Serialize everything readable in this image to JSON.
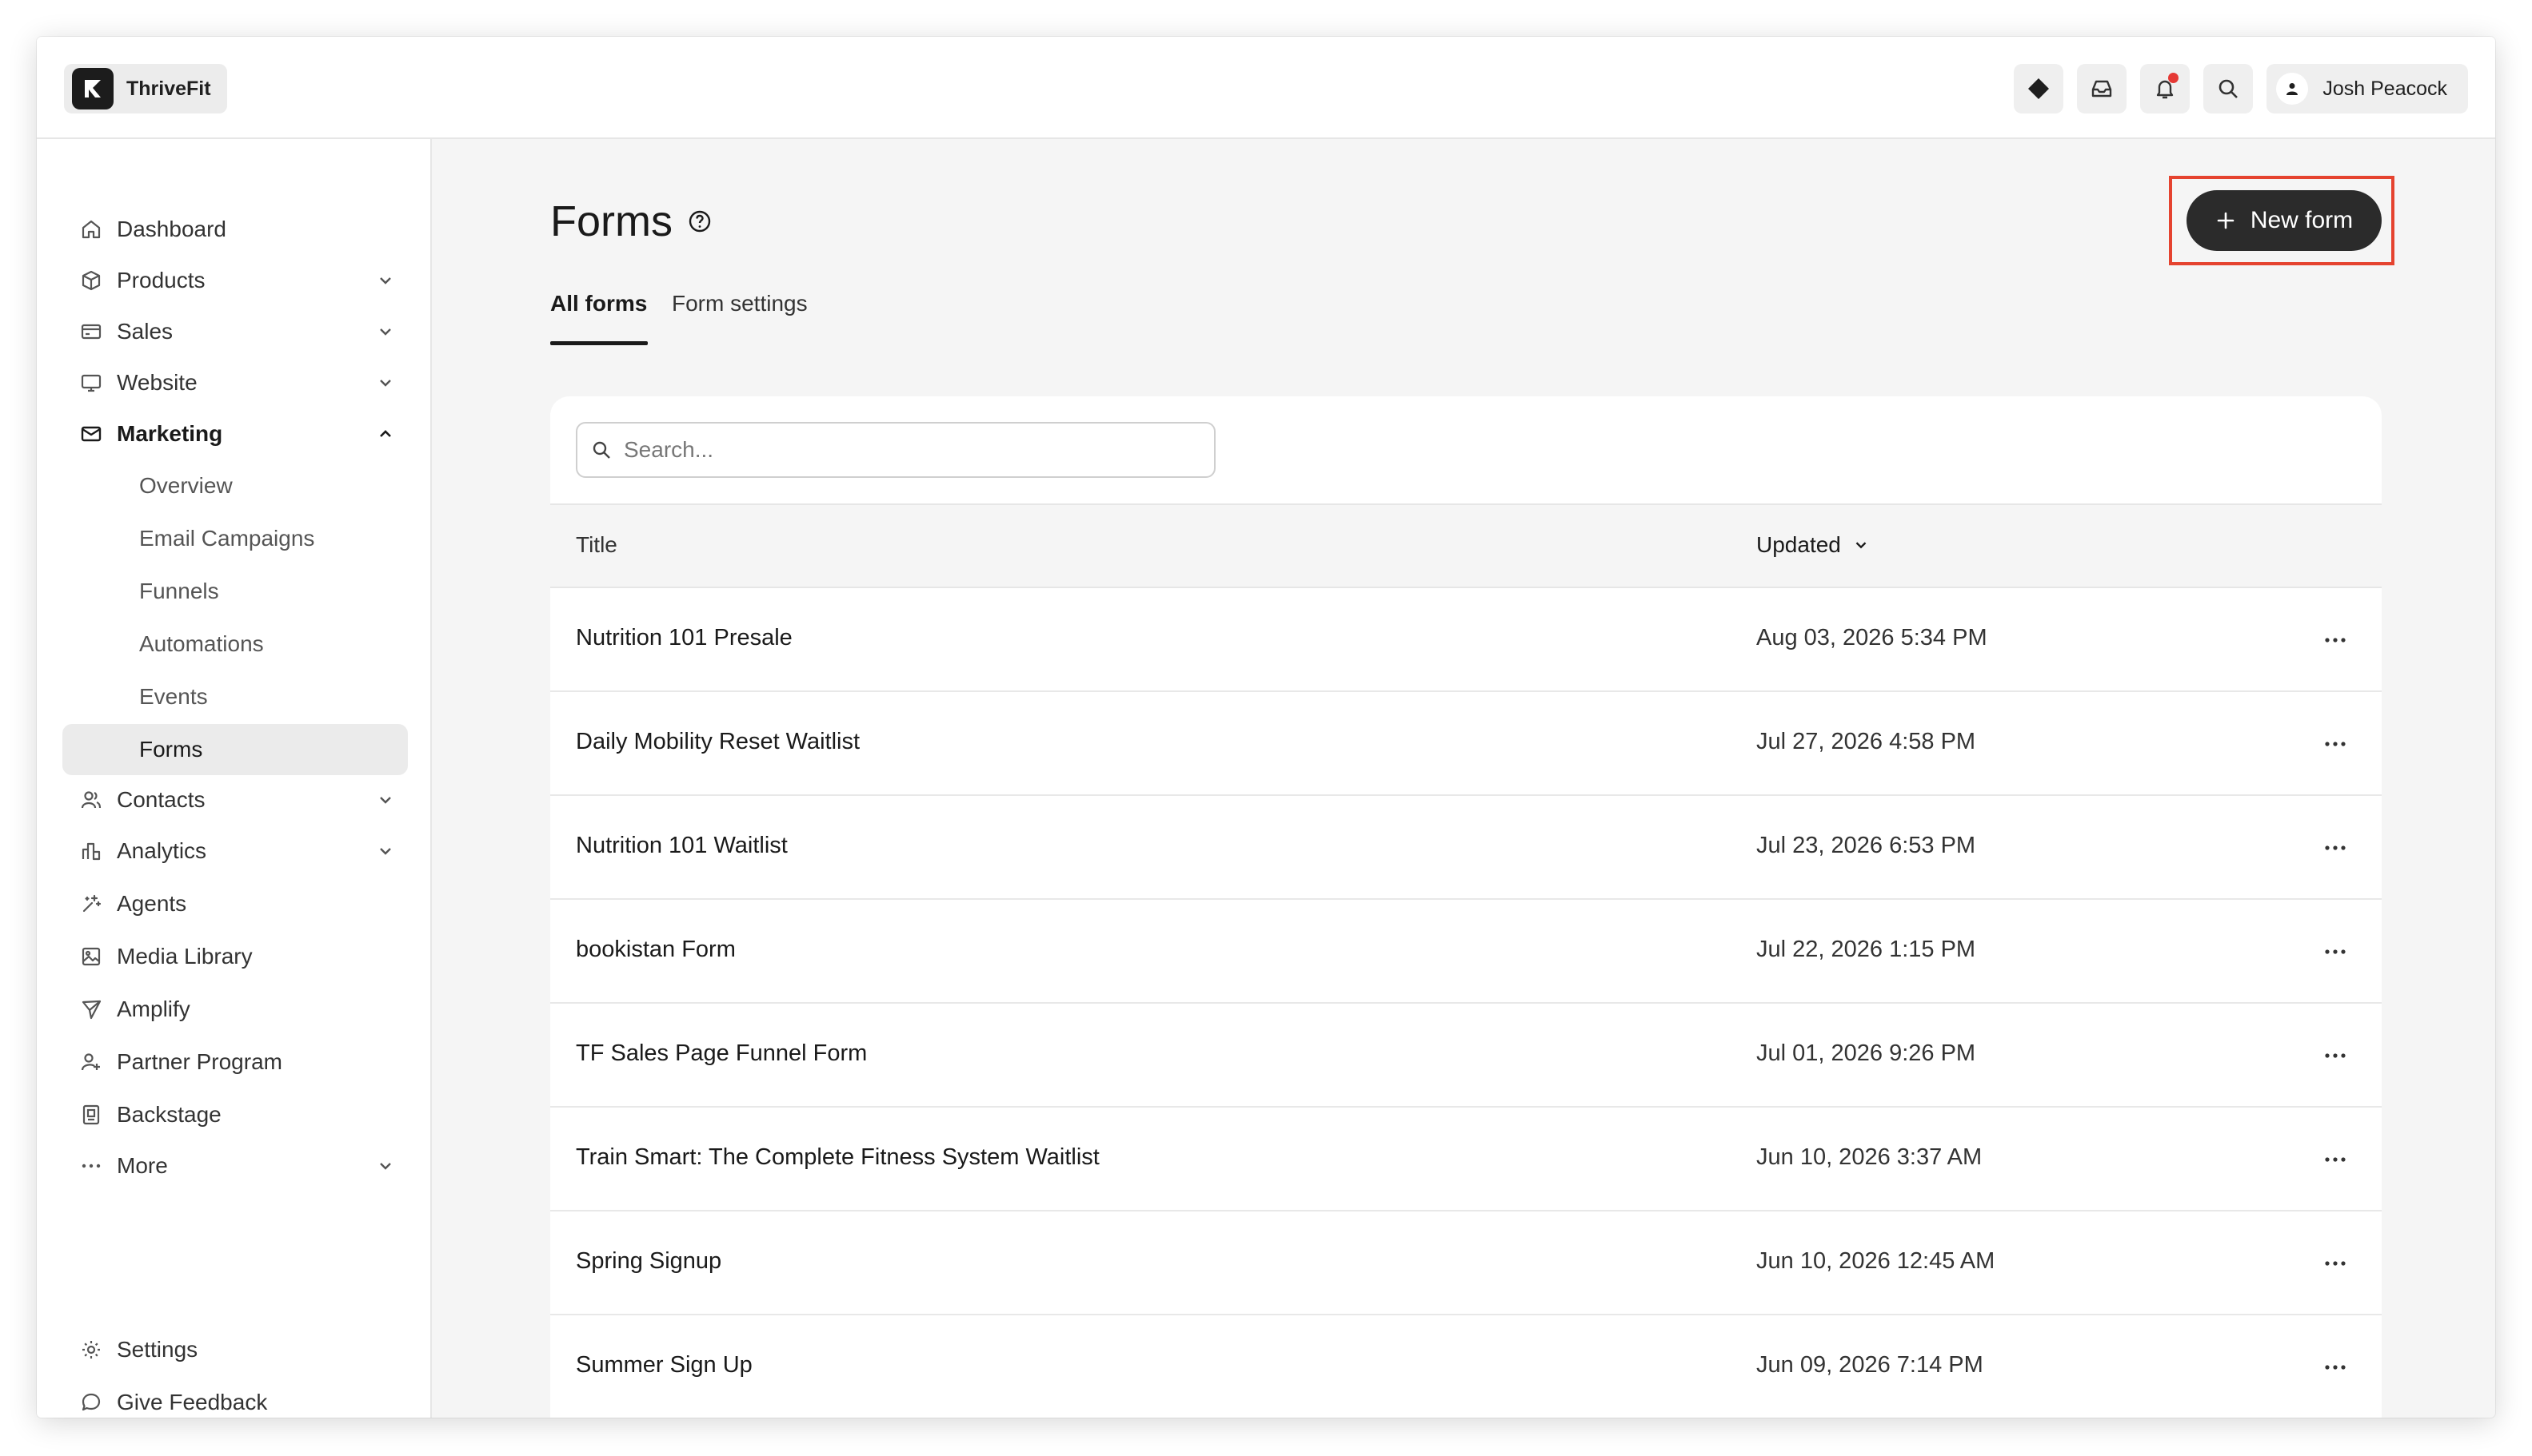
{
  "app": {
    "brand_name": "ThriveFit",
    "user_name": "Josh Peacock"
  },
  "topbar": {
    "icons": [
      "diamond-icon",
      "inbox-icon",
      "bell-icon",
      "search-icon",
      "user-icon"
    ],
    "notification_dot_color": "#e53935"
  },
  "sidebar": {
    "items": [
      {
        "label": "Dashboard",
        "icon": "home-icon"
      },
      {
        "label": "Products",
        "icon": "box-icon",
        "expandable": true
      },
      {
        "label": "Sales",
        "icon": "credit-card-icon",
        "expandable": true
      },
      {
        "label": "Website",
        "icon": "monitor-icon",
        "expandable": true
      },
      {
        "label": "Marketing",
        "icon": "mail-icon",
        "expanded": true
      },
      {
        "label": "Contacts",
        "icon": "users-icon",
        "expandable": true
      },
      {
        "label": "Analytics",
        "icon": "bar-chart-icon",
        "expandable": true
      },
      {
        "label": "Agents",
        "icon": "sparkle-icon"
      },
      {
        "label": "Media Library",
        "icon": "image-icon"
      },
      {
        "label": "Amplify",
        "icon": "paper-plane-icon"
      },
      {
        "label": "Partner Program",
        "icon": "partner-icon"
      },
      {
        "label": "Backstage",
        "icon": "backstage-icon"
      },
      {
        "label": "More",
        "icon": "more-icon",
        "expandable": true
      }
    ],
    "marketing_sub": [
      "Overview",
      "Email Campaigns",
      "Funnels",
      "Automations",
      "Events",
      "Forms"
    ],
    "active_sub": "Forms",
    "footer": [
      {
        "label": "Settings",
        "icon": "gear-icon"
      },
      {
        "label": "Give Feedback",
        "icon": "chat-bubble-icon"
      }
    ]
  },
  "main": {
    "title": "Forms",
    "tabs": [
      "All forms",
      "Form settings"
    ],
    "active_tab": "All forms",
    "new_form_label": "New form",
    "search_placeholder": "Search...",
    "columns": {
      "title": "Title",
      "updated": "Updated"
    },
    "rows": [
      {
        "title": "Nutrition 101 Presale",
        "updated": "Aug 03, 2026 5:34 PM"
      },
      {
        "title": "Daily Mobility Reset Waitlist",
        "updated": "Jul 27, 2026 4:58 PM"
      },
      {
        "title": "Nutrition 101 Waitlist",
        "updated": "Jul 23, 2026 6:53 PM"
      },
      {
        "title": "bookistan Form",
        "updated": "Jul 22, 2026 1:15 PM"
      },
      {
        "title": "TF Sales Page Funnel Form",
        "updated": "Jul 01, 2026 9:26 PM"
      },
      {
        "title": "Train Smart: The Complete Fitness System Waitlist",
        "updated": "Jun 10, 2026 3:37 AM"
      },
      {
        "title": "Spring Signup",
        "updated": "Jun 10, 2026 12:45 AM"
      },
      {
        "title": "Summer Sign Up",
        "updated": "Jun 09, 2026 7:14 PM"
      }
    ]
  },
  "colors": {
    "highlight": "#e5432f",
    "primary_button": "#2b2b2b"
  }
}
